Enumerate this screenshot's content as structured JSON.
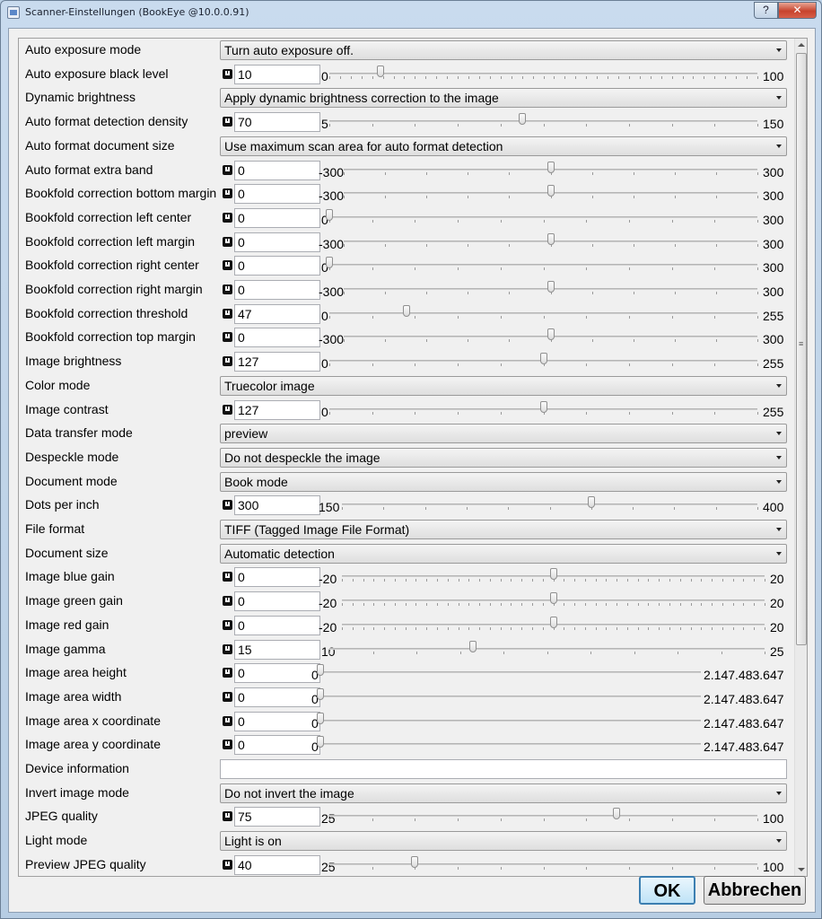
{
  "window": {
    "title": "Scanner-Einstellungen (BookEye @10.0.0.91)",
    "help_label": "?",
    "close_label": "✕"
  },
  "settings": [
    {
      "label": "Auto exposure mode",
      "type": "combo",
      "value": "Turn auto exposure off."
    },
    {
      "label": "Auto exposure black level",
      "type": "slider",
      "value": "10",
      "min": "0",
      "max": "100",
      "pos": 0.12
    },
    {
      "label": "Dynamic brightness",
      "type": "combo",
      "value": "Apply dynamic brightness correction to the image"
    },
    {
      "label": "Auto format detection density",
      "type": "slider",
      "value": "70",
      "min": "5",
      "max": "150",
      "pos": 0.45
    },
    {
      "label": "Auto format document size",
      "type": "combo",
      "value": "Use maximum scan area for auto format detection"
    },
    {
      "label": "Auto format extra band",
      "type": "slider",
      "value": "0",
      "min": "-300",
      "max": "300",
      "pos": 0.5
    },
    {
      "label": "Bookfold correction bottom margin",
      "type": "slider",
      "value": "0",
      "min": "-300",
      "max": "300",
      "pos": 0.5
    },
    {
      "label": "Bookfold correction left center",
      "type": "slider",
      "value": "0",
      "min": "0",
      "max": "300",
      "pos": 0.0
    },
    {
      "label": "Bookfold correction left margin",
      "type": "slider",
      "value": "0",
      "min": "-300",
      "max": "300",
      "pos": 0.5
    },
    {
      "label": "Bookfold correction right center",
      "type": "slider",
      "value": "0",
      "min": "0",
      "max": "300",
      "pos": 0.0
    },
    {
      "label": "Bookfold correction right margin",
      "type": "slider",
      "value": "0",
      "min": "-300",
      "max": "300",
      "pos": 0.5
    },
    {
      "label": "Bookfold correction threshold",
      "type": "slider",
      "value": "47",
      "min": "0",
      "max": "255",
      "pos": 0.18
    },
    {
      "label": "Bookfold correction top margin",
      "type": "slider",
      "value": "0",
      "min": "-300",
      "max": "300",
      "pos": 0.5
    },
    {
      "label": "Image brightness",
      "type": "slider",
      "value": "127",
      "min": "0",
      "max": "255",
      "pos": 0.5
    },
    {
      "label": "Color mode",
      "type": "combo",
      "value": "Truecolor image"
    },
    {
      "label": "Image contrast",
      "type": "slider",
      "value": "127",
      "min": "0",
      "max": "255",
      "pos": 0.5
    },
    {
      "label": "Data transfer mode",
      "type": "combo",
      "value": "preview"
    },
    {
      "label": "Despeckle mode",
      "type": "combo",
      "value": "Do not despeckle the image"
    },
    {
      "label": "Document mode",
      "type": "combo",
      "value": "Book mode"
    },
    {
      "label": "Dots per inch",
      "type": "slider",
      "value": "300",
      "min": "150",
      "max": "400",
      "pos": 0.6
    },
    {
      "label": "File format",
      "type": "combo",
      "value": "TIFF (Tagged Image File Format)"
    },
    {
      "label": "Document size",
      "type": "combo",
      "value": "Automatic detection"
    },
    {
      "label": "Image blue gain",
      "type": "slider",
      "value": "0",
      "min": "-20",
      "max": "20",
      "pos": 0.5
    },
    {
      "label": "Image green gain",
      "type": "slider",
      "value": "0",
      "min": "-20",
      "max": "20",
      "pos": 0.5
    },
    {
      "label": "Image red gain",
      "type": "slider",
      "value": "0",
      "min": "-20",
      "max": "20",
      "pos": 0.5
    },
    {
      "label": "Image gamma",
      "type": "slider",
      "value": "15",
      "min": "10",
      "max": "25",
      "pos": 0.33
    },
    {
      "label": "Image area height",
      "type": "slider-wide",
      "value": "0",
      "min": "0",
      "max": "2.147.483.647",
      "pos": 0.0
    },
    {
      "label": "Image area width",
      "type": "slider-wide",
      "value": "0",
      "min": "0",
      "max": "2.147.483.647",
      "pos": 0.0
    },
    {
      "label": "Image area x coordinate",
      "type": "slider-wide",
      "value": "0",
      "min": "0",
      "max": "2.147.483.647",
      "pos": 0.0
    },
    {
      "label": "Image area y coordinate",
      "type": "slider-wide",
      "value": "0",
      "min": "0",
      "max": "2.147.483.647",
      "pos": 0.0
    },
    {
      "label": "Device information",
      "type": "text",
      "value": ""
    },
    {
      "label": "Invert image mode",
      "type": "combo",
      "value": "Do not invert the image"
    },
    {
      "label": "JPEG quality",
      "type": "slider",
      "value": "75",
      "min": "25",
      "max": "100",
      "pos": 0.67
    },
    {
      "label": "Light mode",
      "type": "combo",
      "value": "Light is on"
    },
    {
      "label": "Preview JPEG quality",
      "type": "slider",
      "value": "40",
      "min": "25",
      "max": "100",
      "pos": 0.2
    }
  ],
  "buttons": {
    "ok": "OK",
    "cancel": "Abbrechen"
  }
}
